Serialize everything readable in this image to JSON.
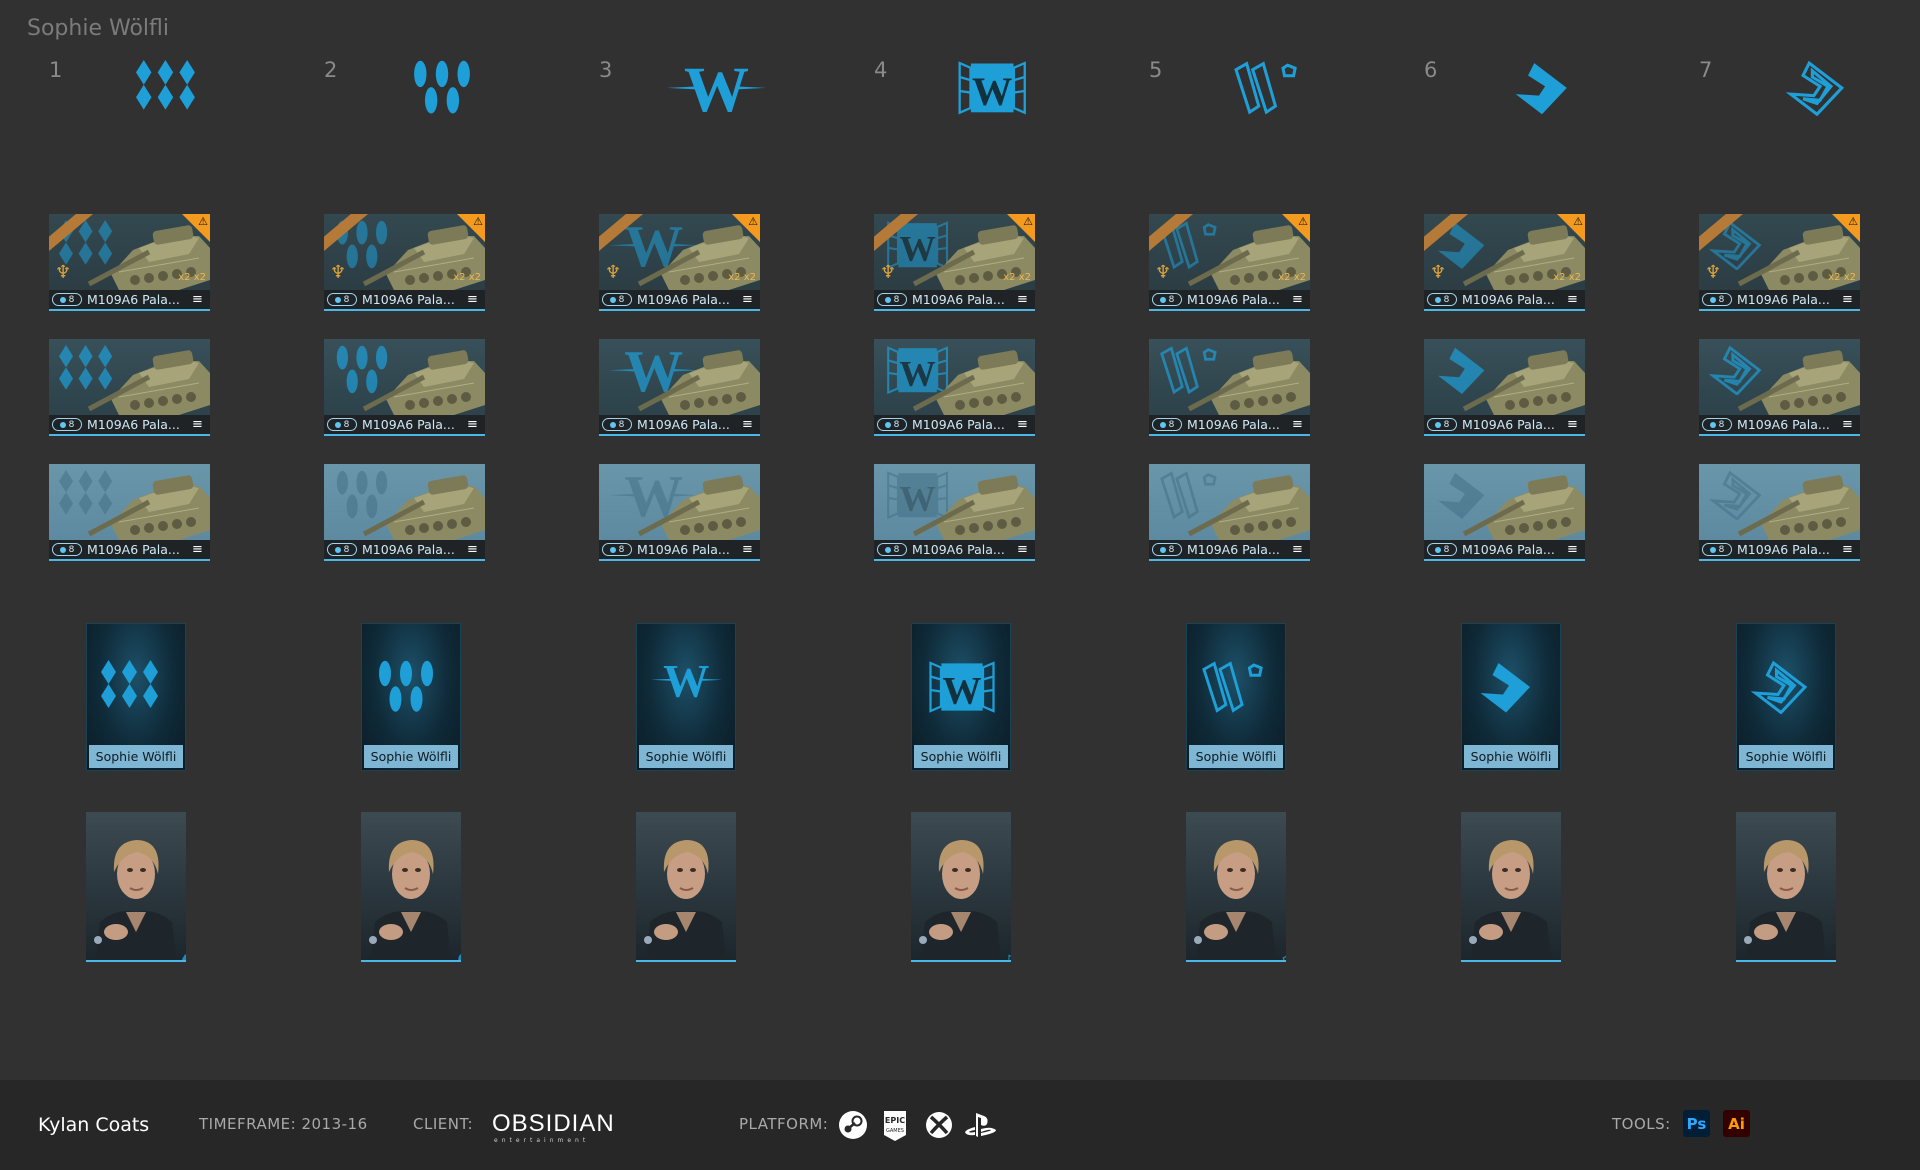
{
  "title": "Sophie Wölfli",
  "columns": [
    "1",
    "2",
    "3",
    "4",
    "5",
    "6",
    "7"
  ],
  "card": {
    "vehicle_name": "M109A6 Pala...",
    "tier": "8",
    "multiplier": "x2 x2",
    "warning_symbol": "⚠",
    "menu_symbol": "≡"
  },
  "commander_name": "Sophie Wölfli",
  "footer": {
    "author": "Kylan Coats",
    "timeframe": "TIMEFRAME: 2013-16",
    "client_label": "CLIENT:",
    "client_name": "OBSIDIAN",
    "client_sub": "entertainment",
    "platform_label": "PLATFORM:",
    "platforms": [
      "steam-icon",
      "epic-games-icon",
      "xbox-icon",
      "playstation-icon"
    ],
    "tools_label": "TOOLS:",
    "tools": [
      {
        "label": "Ps",
        "color": "#31a8ff",
        "bg": "#001e36"
      },
      {
        "label": "Ai",
        "color": "#ff9a00",
        "bg": "#330000"
      }
    ]
  },
  "colors": {
    "accent": "#1e9fd8",
    "accent_light": "#5fc6f1",
    "background": "#313131",
    "footer": "#272727"
  }
}
